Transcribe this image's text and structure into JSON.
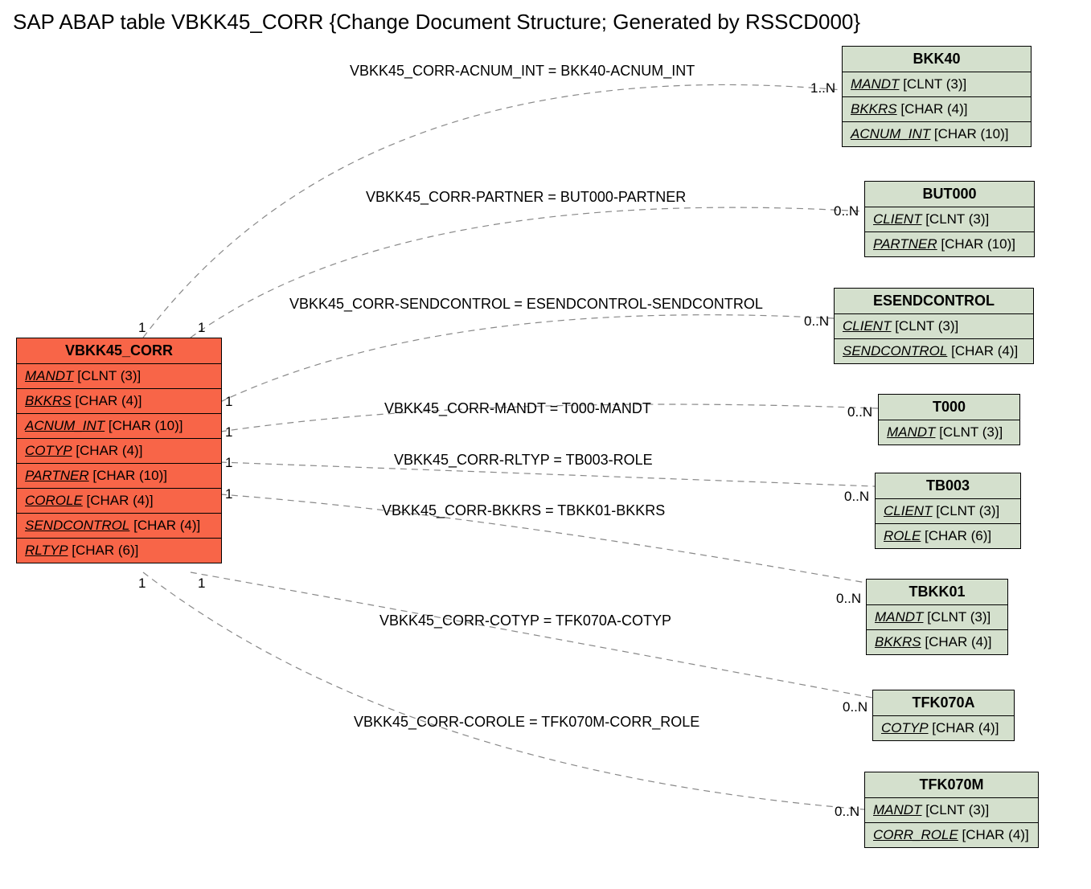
{
  "title": "SAP ABAP table VBKK45_CORR {Change Document Structure; Generated by RSSCD000}",
  "main_entity": {
    "name": "VBKK45_CORR",
    "fields": [
      {
        "name": "MANDT",
        "type": "[CLNT (3)]"
      },
      {
        "name": "BKKRS",
        "type": "[CHAR (4)]"
      },
      {
        "name": "ACNUM_INT",
        "type": "[CHAR (10)]"
      },
      {
        "name": "COTYP",
        "type": "[CHAR (4)]"
      },
      {
        "name": "PARTNER",
        "type": "[CHAR (10)]"
      },
      {
        "name": "COROLE",
        "type": "[CHAR (4)]"
      },
      {
        "name": "SENDCONTROL",
        "type": "[CHAR (4)]"
      },
      {
        "name": "RLTYP",
        "type": "[CHAR (6)]"
      }
    ]
  },
  "related_entities": [
    {
      "name": "BKK40",
      "fields": [
        {
          "name": "MANDT",
          "type": "[CLNT (3)]"
        },
        {
          "name": "BKKRS",
          "type": "[CHAR (4)]"
        },
        {
          "name": "ACNUM_INT",
          "type": "[CHAR (10)]"
        }
      ]
    },
    {
      "name": "BUT000",
      "fields": [
        {
          "name": "CLIENT",
          "type": "[CLNT (3)]"
        },
        {
          "name": "PARTNER",
          "type": "[CHAR (10)]"
        }
      ]
    },
    {
      "name": "ESENDCONTROL",
      "fields": [
        {
          "name": "CLIENT",
          "type": "[CLNT (3)]"
        },
        {
          "name": "SENDCONTROL",
          "type": "[CHAR (4)]"
        }
      ]
    },
    {
      "name": "T000",
      "fields": [
        {
          "name": "MANDT",
          "type": "[CLNT (3)]"
        }
      ]
    },
    {
      "name": "TB003",
      "fields": [
        {
          "name": "CLIENT",
          "type": "[CLNT (3)]"
        },
        {
          "name": "ROLE",
          "type": "[CHAR (6)]"
        }
      ]
    },
    {
      "name": "TBKK01",
      "fields": [
        {
          "name": "MANDT",
          "type": "[CLNT (3)]"
        },
        {
          "name": "BKKRS",
          "type": "[CHAR (4)]"
        }
      ]
    },
    {
      "name": "TFK070A",
      "fields": [
        {
          "name": "COTYP",
          "type": "[CHAR (4)]"
        }
      ]
    },
    {
      "name": "TFK070M",
      "fields": [
        {
          "name": "MANDT",
          "type": "[CLNT (3)]"
        },
        {
          "name": "CORR_ROLE",
          "type": "[CHAR (4)]"
        }
      ]
    }
  ],
  "relations": [
    {
      "label": "VBKK45_CORR-ACNUM_INT = BKK40-ACNUM_INT",
      "left_card": "1",
      "right_card": "1..N"
    },
    {
      "label": "VBKK45_CORR-PARTNER = BUT000-PARTNER",
      "left_card": "1",
      "right_card": "0..N"
    },
    {
      "label": "VBKK45_CORR-SENDCONTROL = ESENDCONTROL-SENDCONTROL",
      "left_card": "1",
      "right_card": "0..N"
    },
    {
      "label": "VBKK45_CORR-MANDT = T000-MANDT",
      "left_card": "1",
      "right_card": "0..N"
    },
    {
      "label": "VBKK45_CORR-RLTYP = TB003-ROLE",
      "left_card": "1",
      "right_card": "0..N"
    },
    {
      "label": "VBKK45_CORR-BKKRS = TBKK01-BKKRS",
      "left_card": "1",
      "right_card": "0..N"
    },
    {
      "label": "VBKK45_CORR-COTYP = TFK070A-COTYP",
      "left_card": "1",
      "right_card": "0..N"
    },
    {
      "label": "VBKK45_CORR-COROLE = TFK070M-CORR_ROLE",
      "left_card": "1",
      "right_card": "0..N"
    }
  ]
}
